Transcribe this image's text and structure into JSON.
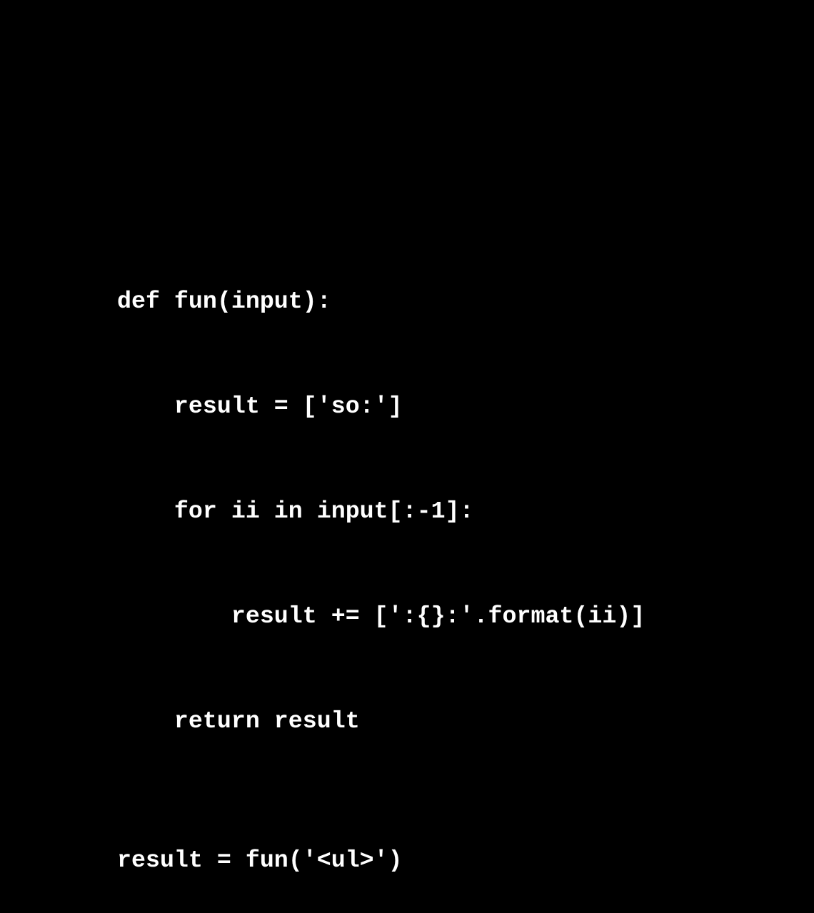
{
  "code": {
    "lines": [
      "def fun(input):",
      "    result = ['so:']",
      "    for ii in input[:-1]:",
      "        result += [':{}:'.format(ii)]",
      "    return result",
      "result = fun('<ul>')"
    ]
  },
  "colors": {
    "background": "#000000",
    "text": "#ffffff"
  }
}
